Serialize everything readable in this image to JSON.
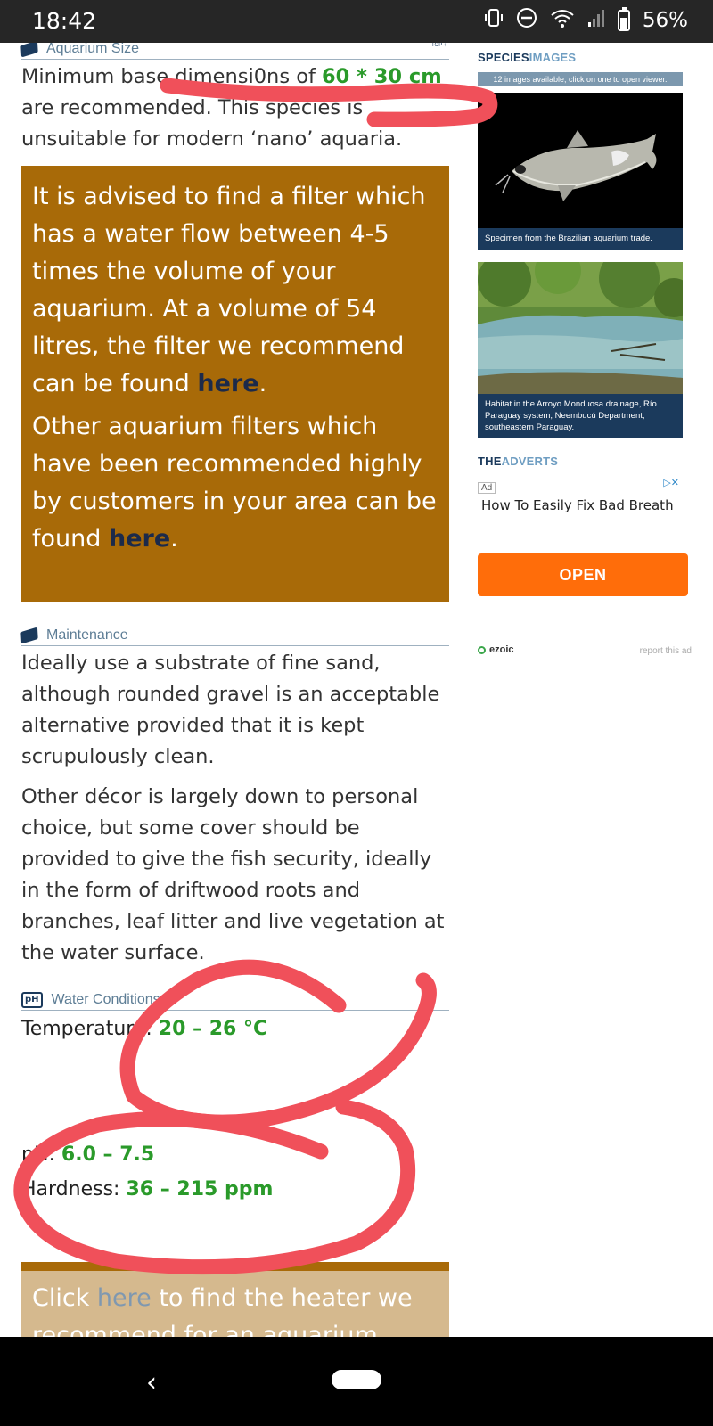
{
  "status_bar": {
    "time": "18:42",
    "battery": "56%"
  },
  "aquarium_size": {
    "heading": "Aquarium Size",
    "top_link": "TOP ↑",
    "text_before": "Minimum base dimensi0ns of ",
    "dimensions": "60 * 30 cm",
    "text_after": " are recommended. This species is unsuitable for modern ‘nano’ aquaria."
  },
  "filter_box": {
    "p1": "It is advised to find a filter which has a water flow between 4-5 times the volume of your aquarium. At a volume of 54 litres, the filter we recommend can be found ",
    "p1_link": "here",
    "p1_end": ".",
    "p2": "Other aquarium filters which have been recommended highly by customers in your area can be found ",
    "p2_link": "here",
    "p2_end": "."
  },
  "maintenance": {
    "heading": "Maintenance",
    "p1": "Ideally use a substrate of fine sand, although rounded gravel is an acceptable alternative provided that it is kept scrupulously clean.",
    "p2": "Other décor is largely down to personal choice, but some cover should be provided to give the fish security, ideally in the form of driftwood roots and branches, leaf litter and live vegetation at the water surface."
  },
  "water_conditions": {
    "heading": "Water Conditions",
    "temperature_label": "Temperature: ",
    "temperature_value": "20 – 26 °C",
    "ph_label": "pH: ",
    "ph_value": "6.0 – 7.5",
    "hardness_label": "Hardness: ",
    "hardness_value": "36 – 215 ppm"
  },
  "heater_box": {
    "before": "Click ",
    "link": "here",
    "after": " to find the heater we recommend for an aquarium"
  },
  "species_images": {
    "title_bold": "SPECIES",
    "title_light": "IMAGES",
    "count_text": "12 images available; click on one to open viewer.",
    "caption1": "Specimen from the Brazilian aquarium trade.",
    "caption2": "Habitat in the Arroyo Monduosa drainage, Río Paraguay system, Neembucú Department, southeastern Paraguay."
  },
  "adverts": {
    "title_bold": "THE",
    "title_light": "ADVERTS",
    "ad_label": "Ad",
    "ad_close": "▷✕",
    "headline": "How To Easily Fix Bad Breath",
    "button": "OPEN",
    "ezoic": "ezoic",
    "report": "report this ad"
  },
  "colors": {
    "accent_green": "#2a9a2a",
    "box_orange": "#a86a08",
    "heading_blue": "#5d7d95",
    "open_button": "#ff6d0a",
    "scribble_red": "#f0505a"
  }
}
